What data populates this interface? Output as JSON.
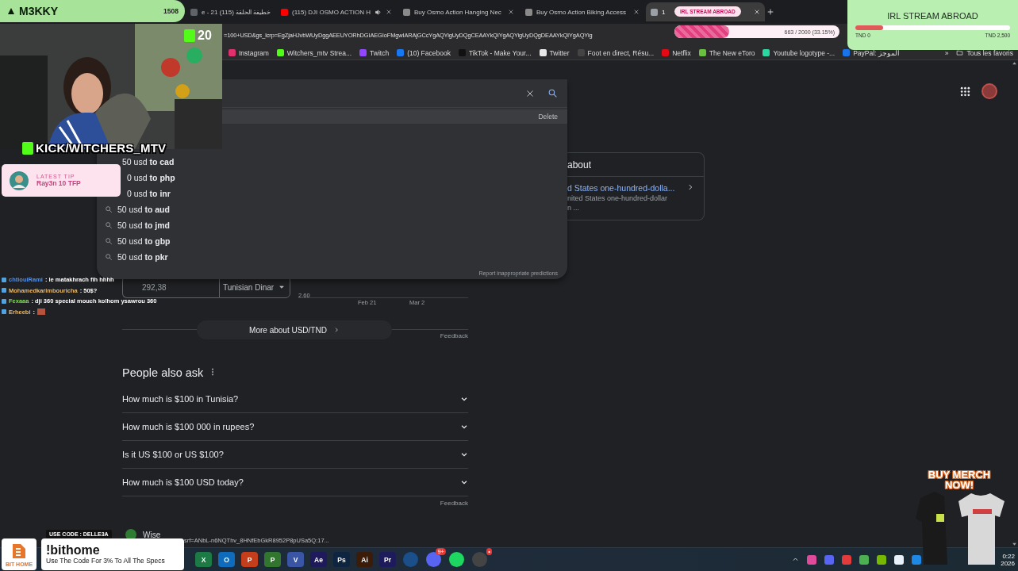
{
  "stream_header": {
    "channel": "M3KKY",
    "count": "1508"
  },
  "tabs": [
    {
      "label": "e - 21 خطيفة الحلقة (115)",
      "selected": false,
      "color": "#5f6368"
    },
    {
      "label": "(115) DJI OSMO ACTION H",
      "selected": false,
      "color": "#ff0000",
      "audio": true
    },
    {
      "label": "Buy Osmo Action Hanging Nec",
      "selected": false,
      "color": "#8a8a8a"
    },
    {
      "label": "Buy Osmo Action Biking Access",
      "selected": false,
      "color": "#8a8a8a"
    },
    {
      "label": "1",
      "selected": true,
      "color": "#9aa0a6"
    }
  ],
  "address": {
    "url": "=100+USD&gs_lcrp=EgZjaHJvbWUyDggAEEUYORhDGIAEGIoFMgwIARAjGCcYgAQYigUyDQgCEAAYkQIYgAQYigUyDQgDEAAYkQIYgAQYig"
  },
  "bookmarks": [
    {
      "label": "Instagram",
      "color": "#e1306c"
    },
    {
      "label": "Witchers_mtv Strea...",
      "color": "#53fc18"
    },
    {
      "label": "Twitch",
      "color": "#9146ff"
    },
    {
      "label": "(10) Facebook",
      "color": "#1877f2"
    },
    {
      "label": "TikTok - Make Your...",
      "color": "#111111"
    },
    {
      "label": "Twitter",
      "color": "#e8e8e8"
    },
    {
      "label": "Foot en direct, Résu...",
      "color": "#444444"
    },
    {
      "label": "Netflix",
      "color": "#e50914"
    },
    {
      "label": "The New eToro",
      "color": "#6ac13d"
    },
    {
      "label": "Youtube logotype -...",
      "color": "#2bd6a0"
    },
    {
      "label": "PayPal: الموجز",
      "color": "#1a73e8"
    }
  ],
  "bookmarks_more": "»",
  "bookmarks_all": "Tous les favoris",
  "search_panel": {
    "delete": "Delete",
    "suggestions": [
      {
        "text": "50 usd **to cad**",
        "icon": false
      },
      {
        "text": "0 usd **to php**",
        "icon": false
      },
      {
        "text": "0 usd **to inr**",
        "icon": false
      },
      {
        "text": "50 usd **to aud**",
        "icon": true
      },
      {
        "text": "50 usd **to jmd**",
        "icon": true
      },
      {
        "text": "50 usd **to gbp**",
        "icon": true
      },
      {
        "text": "50 usd **to pkr**",
        "icon": true
      }
    ],
    "report": "Report inappropriate predictions"
  },
  "about_card": {
    "title": "about",
    "link": "d States one-hundred-dolla...",
    "line_1": "nited States one-hundred-dollar",
    "line_2": "n ..."
  },
  "converter": {
    "value": "292,38",
    "currency": "Tunisian Dinar",
    "y_tick": "2.60",
    "x_ticks": [
      "Feb 21",
      "Mar 2"
    ]
  },
  "more_button": "More about USD/TND",
  "feedback_1": "Feedback",
  "people_also_ask": {
    "title": "People also ask",
    "questions": [
      {
        "text": "How much is $100 in Tunisia?",
        "expanded": false
      },
      {
        "text": "How much is $100 000 in rupees?",
        "expanded": false
      },
      {
        "text": "Is it US $100 or US $100?",
        "expanded": false
      },
      {
        "text": "How much is $100 USD today?",
        "expanded": false
      }
    ]
  },
  "feedback_2": "Feedback",
  "next_result": "Wise",
  "status_url": "srf=ANbL-n6NQThv_8HNfEbGkR8952P8pUSa5Q:17...",
  "kick_badge": "20",
  "kick_label": "KICK/WITCHERS_MTV",
  "latest_tip": {
    "heading": "LATEST TIP",
    "text": "Ray3n 10 TFP"
  },
  "chat": [
    {
      "user": "chtiouiRami",
      "color": "#5b8fd9",
      "message": ": le matakhrach fih hhhh"
    },
    {
      "user": "Mohamedkarimbouricha",
      "color": "#e8b86a",
      "message": ": 50$?"
    },
    {
      "user": "Fexaaa",
      "color": "#7ddc4f",
      "message": ": dji 360 special mouch kolhom ysawrou 360"
    },
    {
      "user": "Erheebi",
      "color": "#e8b86a",
      "message": ":",
      "emote": true
    }
  ],
  "goal_bar": {
    "level": 0.3315,
    "reading": "663 / 2000 (33.15%)"
  },
  "irl_pill": "IRL STREAM ABROAD",
  "irl_card": {
    "title": "IRL STREAM ABROAD",
    "level": 0.18,
    "min": "TND 0",
    "max": "TND 2,500"
  },
  "ad": {
    "logo_text": "BIT HOME",
    "code": "USE CODE : DELLE3A",
    "title": "!bithome",
    "text": "Use The Code For 3% To All The Specs"
  },
  "merch": "BUY MERCH NOW!",
  "taskbar_apps": [
    {
      "kind": "tile",
      "label": "X",
      "color": "#1d7a45"
    },
    {
      "kind": "tile",
      "label": "O",
      "color": "#0f6cbd"
    },
    {
      "kind": "tile",
      "label": "P",
      "color": "#c43e1c"
    },
    {
      "kind": "tile",
      "label": "P",
      "color": "#31752f"
    },
    {
      "kind": "tile",
      "label": "V",
      "color": "#3955a3"
    },
    {
      "kind": "tile",
      "label": "Ae",
      "color": "#1f1a5c"
    },
    {
      "kind": "tile",
      "label": "Ps",
      "color": "#0d2540"
    },
    {
      "kind": "tile",
      "label": "Ai",
      "color": "#3b1c08"
    },
    {
      "kind": "tile",
      "label": "Pr",
      "color": "#1e1b5c"
    },
    {
      "kind": "round",
      "color": "#1b4f8a"
    },
    {
      "kind": "round",
      "color": "#5865f2",
      "badge": "9+"
    },
    {
      "kind": "round",
      "color": "#1ed760"
    },
    {
      "kind": "round",
      "color": "#444444",
      "badge": "•"
    }
  ],
  "tray": [
    {
      "color": "#e04a9a"
    },
    {
      "color": "#5865f2"
    },
    {
      "color": "#e33b3b"
    },
    {
      "color": "#4caf50"
    },
    {
      "color": "#76b900"
    },
    {
      "color": "#e8f0f8"
    },
    {
      "color": "#1e88e5"
    }
  ],
  "clock": {
    "time": "0:22",
    "date": "2026"
  }
}
